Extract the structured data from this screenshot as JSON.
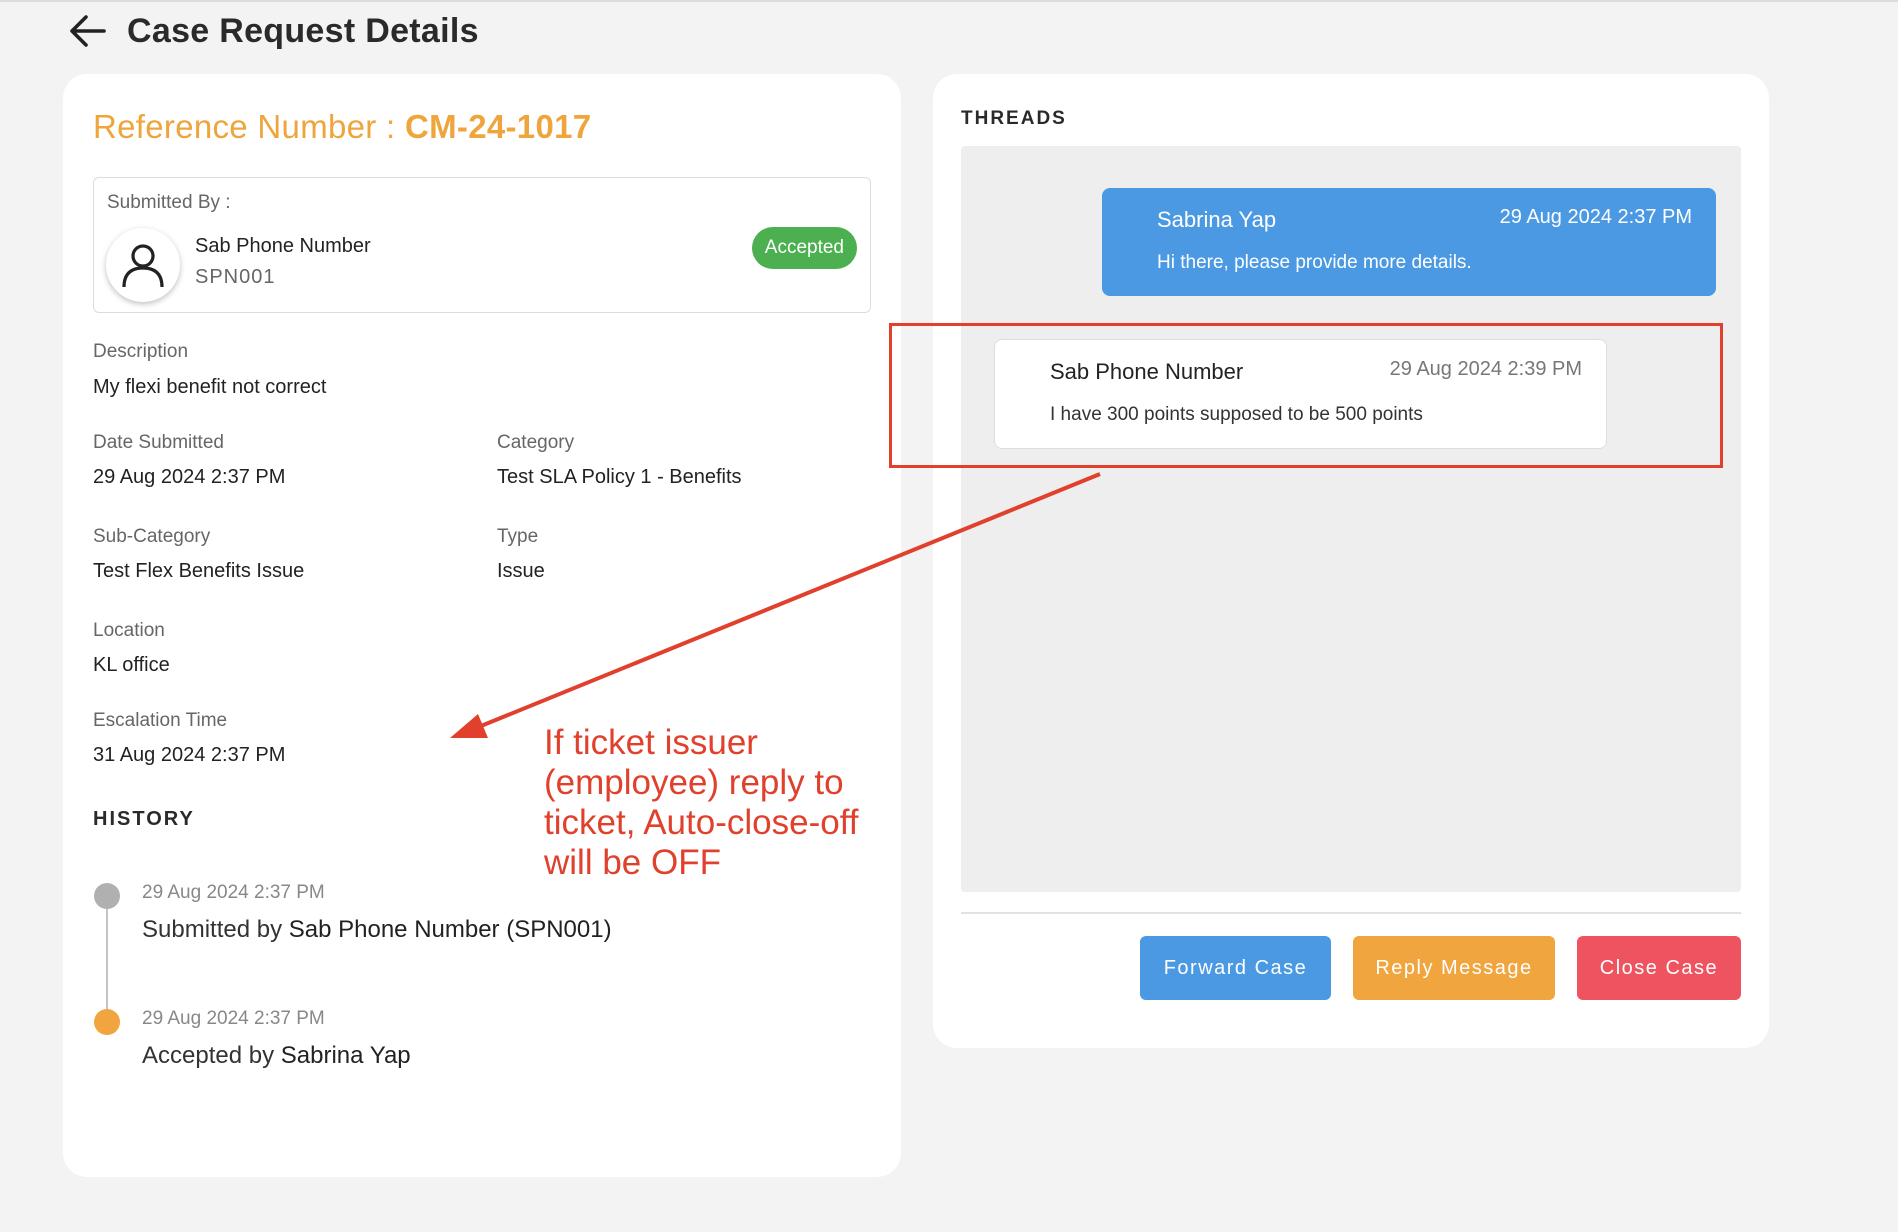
{
  "header": {
    "title": "Case Request Details"
  },
  "details": {
    "reference_label": "Reference Number :",
    "reference_number": "CM-24-1017",
    "submitted_by_label": "Submitted By :",
    "submitter_name": "Sab Phone Number",
    "submitter_id": "SPN001",
    "status": "Accepted",
    "description_label": "Description",
    "description": "My flexi benefit not correct",
    "date_submitted_label": "Date Submitted",
    "date_submitted": "29 Aug 2024 2:37 PM",
    "category_label": "Category",
    "category": "Test SLA Policy 1 - Benefits",
    "subcategory_label": "Sub-Category",
    "subcategory": "Test Flex Benefits Issue",
    "type_label": "Type",
    "type": "Issue",
    "location_label": "Location",
    "location": "KL office",
    "escalation_label": "Escalation Time",
    "escalation_time": "31 Aug 2024 2:37 PM"
  },
  "history": {
    "title": "HISTORY",
    "items": [
      {
        "time": "29 Aug 2024 2:37 PM",
        "prefix": "Submitted by",
        "actor": "Sab Phone Number (SPN001)",
        "dot_color": "#b0b0b0"
      },
      {
        "time": "29 Aug 2024 2:37 PM",
        "prefix": "Accepted by",
        "actor": "Sabrina Yap",
        "dot_color": "#f0a53f"
      }
    ]
  },
  "threads": {
    "title": "THREADS",
    "messages": [
      {
        "name": "Sabrina Yap",
        "time": "29 Aug 2024 2:37 PM",
        "body": "Hi there, please provide more details."
      },
      {
        "name": "Sab Phone Number",
        "time": "29 Aug 2024 2:39 PM",
        "body": "I have 300 points supposed to be 500 points"
      }
    ]
  },
  "actions": {
    "forward": "Forward Case",
    "reply": "Reply Message",
    "close": "Close Case"
  },
  "annotation": {
    "text": "If ticket issuer (employee) reply to ticket, Auto-close-off will be OFF",
    "color": "#e0402c"
  },
  "colors": {
    "accent_orange": "#eea53c",
    "status_green": "#4caf50",
    "blue": "#4a99e2",
    "red": "#ee5360"
  }
}
